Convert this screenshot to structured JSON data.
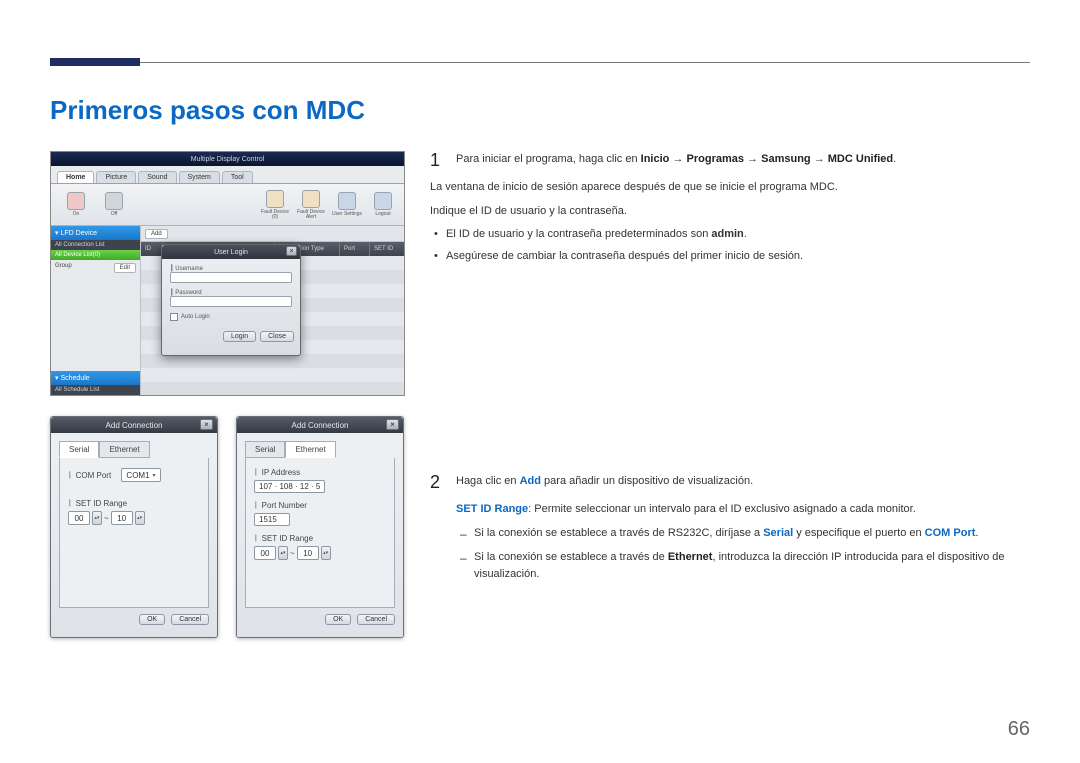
{
  "page": {
    "title": "Primeros pasos con MDC",
    "page_number": "66"
  },
  "step1": {
    "num": "1",
    "lead": "Para iniciar el programa, haga clic en ",
    "path1": "Inicio",
    "arrow": " → ",
    "path2": "Programas",
    "path3": "Samsung",
    "path4": "MDC Unified",
    "tail": ".",
    "p1": "La ventana de inicio de sesión aparece después de que se inicie el programa MDC.",
    "p2": "Indique el ID de usuario y la contraseña.",
    "b1a": "El ID de usuario y la contraseña predeterminados son ",
    "b1b": "admin",
    "b1c": ".",
    "b2": "Asegúrese de cambiar la contraseña después del primer inicio de sesión."
  },
  "step2": {
    "num": "2",
    "lead": "Haga clic en ",
    "add": "Add",
    "tail": " para añadir un dispositivo de visualización.",
    "set_label": "SET ID Range",
    "set_desc": ": Permite seleccionar un intervalo para el ID exclusivo asignado a cada monitor.",
    "d1a": "Si la conexión se establece a través de RS232C, diríjase a ",
    "d1b": "Serial",
    "d1c": " y especifique el puerto en ",
    "d1d": "COM Port",
    "d1e": ".",
    "d2a": "Si la conexión se establece a través de ",
    "d2b": "Ethernet",
    "d2c": ", introduzca la dirección IP introducida para el dispositivo de visualización."
  },
  "mdc": {
    "app_title": "Multiple Display Control",
    "tabs": {
      "home": "Home",
      "picture": "Picture",
      "sound": "Sound",
      "system": "System",
      "tool": "Tool"
    },
    "toolbar": {
      "fault_dev": "Fault Device (0)",
      "fault_alert": "Fault Device Alert",
      "user_settings": "User Settings",
      "logout": "Logout"
    },
    "side": {
      "lfd": "LFD Device",
      "all_conn": "All Connection List",
      "all_dev": "All Device List(0)",
      "group": "Group",
      "edit": "Edit",
      "schedule": "Schedule",
      "all_sched": "All Schedule List"
    },
    "center": {
      "add": "Add",
      "col_id": "ID",
      "col_type": "Connection Type",
      "col_port": "Port",
      "col_setid": "SET ID"
    },
    "login": {
      "title": "User Login",
      "username": "Username",
      "password": "Password",
      "auto": "Auto Login",
      "login_btn": "Login",
      "close_btn": "Close"
    }
  },
  "addconn": {
    "title": "Add Connection",
    "serial": "Serial",
    "ethernet": "Ethernet",
    "com_port": "COM Port",
    "com_val": "COM1",
    "set_id": "SET ID Range",
    "from": "00",
    "to": "10",
    "sep": "~",
    "ok": "OK",
    "cancel": "Cancel",
    "ip": "IP Address",
    "ip_val": "107 · 108 · 12 · 5",
    "portnum": "Port Number",
    "port_val": "1515"
  }
}
